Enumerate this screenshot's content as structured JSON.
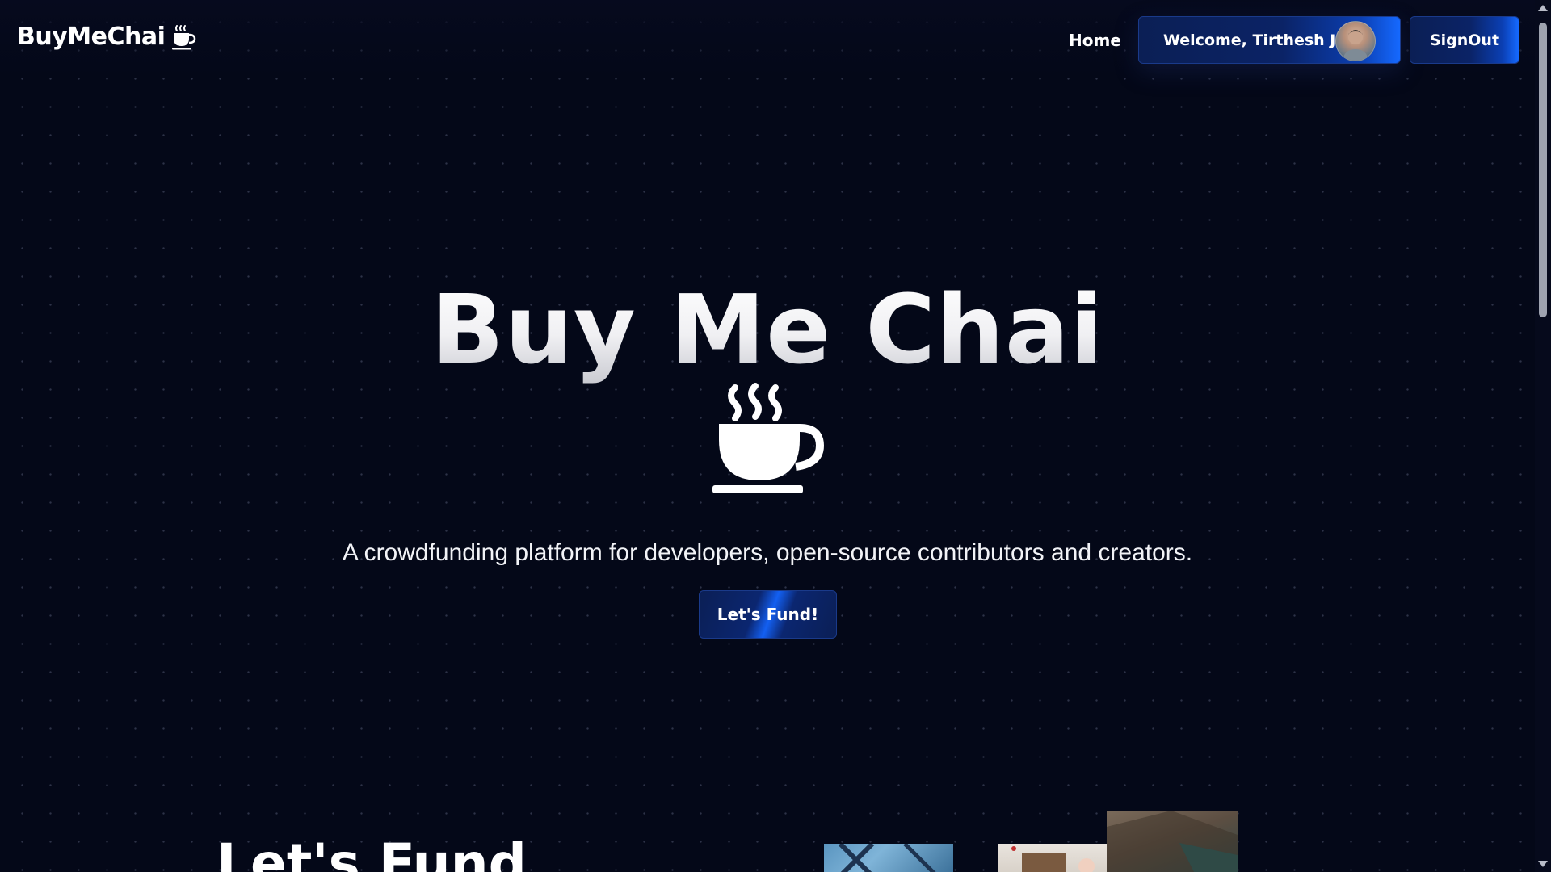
{
  "navbar": {
    "brand": "BuyMeChai",
    "brand_icon": "chai-cup-icon",
    "home_label": "Home",
    "welcome_label": "Welcome, Tirthesh Jain",
    "signout_label": "SignOut"
  },
  "hero": {
    "title": "Buy Me Chai",
    "icon": "steaming-cup-icon",
    "subtitle": "A crowdfunding platform for developers, open-source contributors and creators.",
    "cta_label": "Let's Fund!"
  },
  "section": {
    "heading": "Let's Fund"
  },
  "colors": {
    "background": "#040818",
    "button_gradient_start": "#0b1f55",
    "button_gradient_end": "#1569ff",
    "text": "#ffffff"
  }
}
